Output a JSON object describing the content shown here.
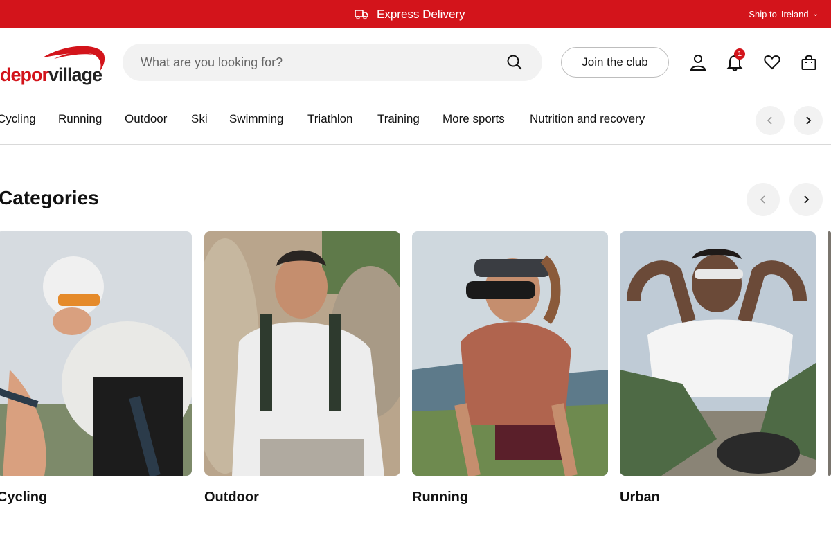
{
  "promo": {
    "express": "Express",
    "delivery": "Delivery",
    "ship_to": "Ship to",
    "country": "Ireland"
  },
  "header": {
    "logo_part1": "depor",
    "logo_part2": "village",
    "search_placeholder": "What are you looking for?",
    "join_label": "Join the club",
    "notifications_count": "1"
  },
  "nav": {
    "items": [
      {
        "label": "Cycling"
      },
      {
        "label": "Running"
      },
      {
        "label": "Outdoor"
      },
      {
        "label": "Ski"
      },
      {
        "label": "Swimming"
      },
      {
        "label": "Triathlon"
      },
      {
        "label": "Training"
      },
      {
        "label": "More sports"
      },
      {
        "label": "Nutrition and recovery"
      }
    ]
  },
  "categories": {
    "title": "Categories",
    "cards": [
      {
        "label": "Cycling"
      },
      {
        "label": "Outdoor"
      },
      {
        "label": "Running"
      },
      {
        "label": "Urban"
      }
    ]
  },
  "colors": {
    "brand_red": "#d3141b",
    "surface_gray": "#f2f2f2"
  },
  "icons": [
    "truck-icon",
    "chevron-down-icon",
    "search-icon",
    "user-icon",
    "bell-icon",
    "heart-icon",
    "bag-icon",
    "chevron-left-icon",
    "chevron-right-icon"
  ]
}
